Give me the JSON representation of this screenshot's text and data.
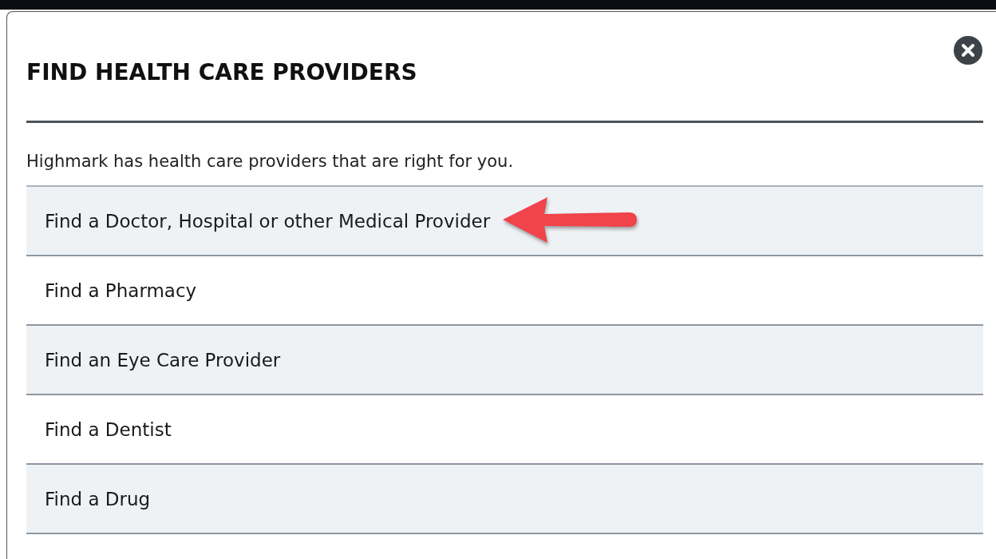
{
  "dialog": {
    "title": "FIND HEALTH CARE PROVIDERS",
    "intro": "Highmark has health care providers that are right for you.",
    "items": [
      {
        "label": "Find a Doctor, Hospital or other Medical Provider",
        "marked": true
      },
      {
        "label": "Find a Pharmacy",
        "marked": false
      },
      {
        "label": "Find an Eye Care Provider",
        "marked": false
      },
      {
        "label": "Find a Dentist",
        "marked": false
      },
      {
        "label": "Find a Drug",
        "marked": false
      }
    ]
  }
}
